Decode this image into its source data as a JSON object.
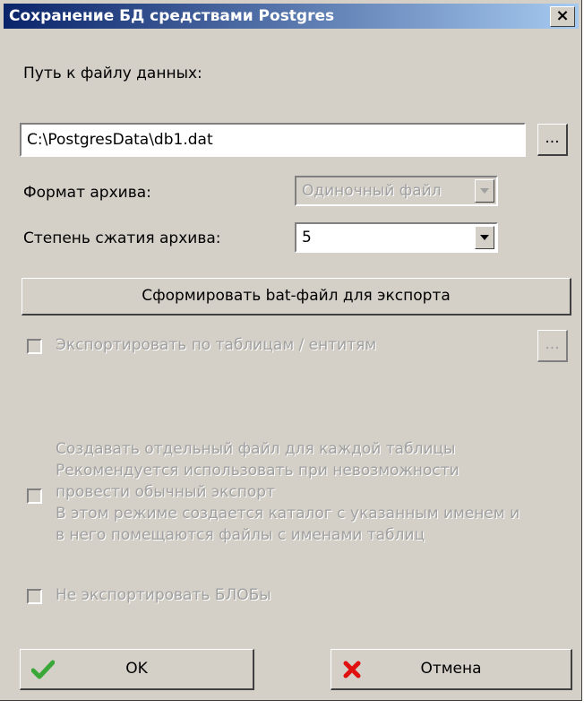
{
  "window": {
    "title": "Сохранение БД средствами Postgres",
    "close_glyph": "×"
  },
  "path": {
    "label": "Путь к файлу данных:",
    "value": "C:\\PostgresData\\db1.dat",
    "browse_label": "..."
  },
  "archive_format": {
    "label": "Формат архива:",
    "selected": "Одиночный файл"
  },
  "compression": {
    "label": "Степень сжатия архива:",
    "selected": "5"
  },
  "bat_button": {
    "label": "Сформировать bat-файл для экспорта"
  },
  "export_by_tables": {
    "label": "Экспортировать по таблицам / ентитям",
    "browse_label": "...",
    "checked": false
  },
  "separate_files": {
    "label": "Создавать отдельный файл для каждой таблицы\nРекомендуется использовать при невозможности\nпровести обычный экспорт\nВ этом режиме создается каталог с указанным именем и\nв него помещаются файлы с именами таблиц",
    "checked": false
  },
  "no_blobs": {
    "label": "Не экспортировать БЛОБы",
    "checked": false
  },
  "buttons": {
    "ok_label": "OK",
    "cancel_label": "Отмена"
  },
  "colors": {
    "title_gradient_start": "#0a246a",
    "title_gradient_end": "#a6caf0",
    "dialog_bg": "#d4d0c8",
    "ok_icon": "#3aa838",
    "cancel_icon": "#e01010"
  },
  "icons": {
    "ok": "checkmark-icon",
    "cancel": "cross-icon"
  }
}
